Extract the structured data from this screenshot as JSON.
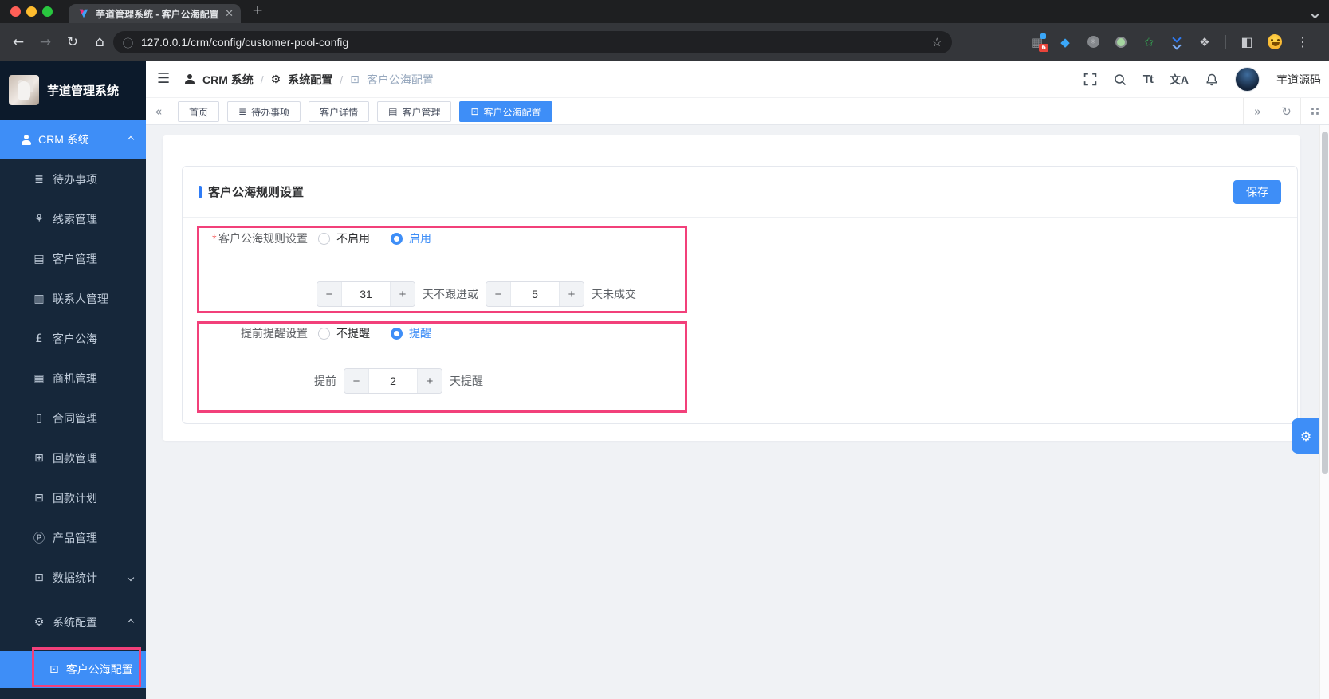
{
  "browser": {
    "tab_title": "芋道管理系统 - 客户公海配置",
    "url": "127.0.0.1/crm/config/customer-pool-config",
    "ext_badge": "6"
  },
  "logo": {
    "title": "芋道管理系统"
  },
  "breadcrumb": {
    "items": [
      {
        "label": "CRM 系统"
      },
      {
        "label": "系统配置"
      },
      {
        "label": "客户公海配置"
      }
    ],
    "separator": "/"
  },
  "header": {
    "username": "芋道源码",
    "font_icon": "Tt",
    "lang_icon": "文A"
  },
  "tags": {
    "items": [
      {
        "label": "首页"
      },
      {
        "label": "待办事项"
      },
      {
        "label": "客户详情"
      },
      {
        "label": "客户管理"
      },
      {
        "label": "客户公海配置"
      }
    ]
  },
  "sidebar": {
    "root_label": "CRM 系统",
    "items": [
      {
        "label": "待办事项"
      },
      {
        "label": "线索管理"
      },
      {
        "label": "客户管理"
      },
      {
        "label": "联系人管理"
      },
      {
        "label": "客户公海"
      },
      {
        "label": "商机管理"
      },
      {
        "label": "合同管理"
      },
      {
        "label": "回款管理"
      },
      {
        "label": "回款计划"
      },
      {
        "label": "产品管理"
      },
      {
        "label": "数据统计"
      },
      {
        "label": "系统配置"
      }
    ],
    "active_child": "客户公海配置"
  },
  "panel": {
    "title": "客户公海规则设置",
    "save": "保存",
    "minus": "−",
    "plus": "+",
    "rule": {
      "label": "客户公海规则设置",
      "opt_off": "不启用",
      "opt_on": "启用",
      "days1": "31",
      "suffix1": "天不跟进或",
      "days2": "5",
      "suffix2": "天未成交"
    },
    "remind": {
      "label": "提前提醒设置",
      "opt_off": "不提醒",
      "opt_on": "提醒",
      "prefix": "提前",
      "days": "2",
      "suffix": "天提醒"
    }
  },
  "colors": {
    "accent": "#3e8ef7",
    "annotation_highlight": "#f2407a",
    "sidebar_bg": "#16273a",
    "sidebar_logo_bg": "#0c1a2b",
    "browser_dark": "#34363a"
  }
}
